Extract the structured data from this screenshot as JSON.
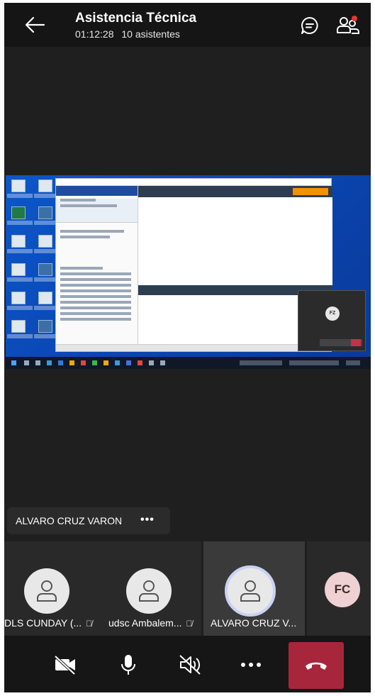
{
  "header": {
    "title": "Asistencia Técnica",
    "duration": "01:12:28",
    "attendees": "10 asistentes"
  },
  "icons": {
    "back": "arrow-left-icon",
    "chat": "chat-icon",
    "people": "people-icon",
    "camera": "camera-off-icon",
    "mic": "microphone-icon",
    "speaker": "speaker-off-icon",
    "more": "more-icon",
    "hangup": "hangup-icon"
  },
  "shared_screen": {
    "pip_initials": "FZ"
  },
  "active_speaker": {
    "name": "ALVARO CRUZ VARON",
    "more": "•••"
  },
  "participants": [
    {
      "name": "DLS CUNDAY (...",
      "muted": true
    },
    {
      "name": "udsc Ambalem...",
      "muted": true
    },
    {
      "name": "ALVARO CRUZ V...",
      "muted": false
    },
    {
      "name": "",
      "initials": "FC"
    }
  ],
  "controls": {
    "more_label": "•••"
  },
  "colors": {
    "background": "#1f1f1f",
    "hangup": "#a8263b",
    "notification": "#e8352b",
    "fc_avatar": "#efd0d3"
  }
}
